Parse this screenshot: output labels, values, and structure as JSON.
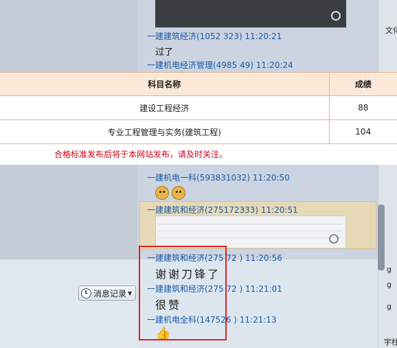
{
  "left_panel": {
    "history_button": "消息记录"
  },
  "right_strip": {
    "labels": [
      "文化",
      "g",
      "g",
      "g",
      "宇柱"
    ]
  },
  "messages": [
    {
      "sender": "一建建筑经济(1052    323) 11:20:21",
      "content": "过了"
    },
    {
      "sender": "一建机电经济管理(4985    49) 11:20:24",
      "content": ""
    },
    {
      "sender": "一建机电一科(593831032) 11:20:50",
      "content": "emoji"
    },
    {
      "sender": "一建建筑和经济(275172333) 11:20:51",
      "content": "image"
    },
    {
      "sender": "一建建筑和经济(275  72    ) 11:20:56",
      "content": "谢谢刀锋了"
    },
    {
      "sender": "一建建筑和经济(275  72    ) 11:21:01",
      "content": "很赞"
    },
    {
      "sender": "一建机电全科(147526    ) 11:21:13",
      "content": "thumbs-up"
    }
  ],
  "score_table": {
    "headers": [
      "科目名称",
      "成绩"
    ],
    "rows": [
      [
        "建设工程经济",
        "88"
      ],
      [
        "专业工程管理与实务(建筑工程)",
        "104"
      ]
    ],
    "notice": "合格标准发布后将于本网站发布，请及时关注。"
  },
  "colors": {
    "link": "#1a5aa8",
    "notice": "#d0021b",
    "header_bg": "#fbe8d6",
    "highlight_box": "#e02020"
  }
}
